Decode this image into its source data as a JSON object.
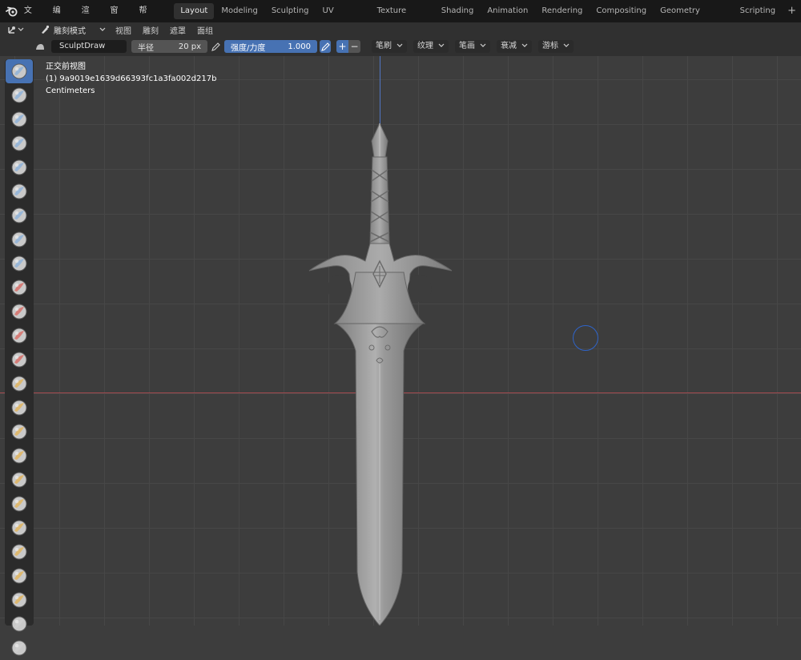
{
  "topbar": {
    "menus": [
      "文件",
      "编辑",
      "渲染",
      "窗口",
      "帮助"
    ],
    "workspace_tabs": [
      "Layout",
      "Modeling",
      "Sculpting",
      "UV Editing",
      "Texture Paint",
      "Shading",
      "Animation",
      "Rendering",
      "Compositing",
      "Geometry Nodes",
      "Scripting"
    ],
    "active_tab": "Layout",
    "add_tab_label": "+"
  },
  "header": {
    "mode": "雕刻模式",
    "menus": [
      "视图",
      "雕刻",
      "遮罩",
      "面组"
    ]
  },
  "tool_settings": {
    "brush_name": "SculptDraw",
    "radius_label": "半径",
    "radius_value": "20 px",
    "strength_label": "强度/力度",
    "strength_value": "1.000",
    "strength_fill": 1.0,
    "direction_add": "+",
    "direction_subtract": "−",
    "dropdowns": [
      "笔刷",
      "纹理",
      "笔画",
      "衰减",
      "游标"
    ]
  },
  "viewport": {
    "view_name": "正交前视图",
    "object_name": "(1) 9a9019e1639d66393fc1a3fa002d217b",
    "units": "Centimeters"
  },
  "toolbar": {
    "tools": [
      "draw",
      "draw-sharp",
      "clay",
      "clay-strips",
      "clay-thumb",
      "layer",
      "inflate",
      "blob",
      "crease",
      "smooth",
      "flatten",
      "fill",
      "scrape",
      "multiplane-scrape",
      "pinch",
      "grab",
      "elastic-deform",
      "snake-hook",
      "thumb",
      "pose",
      "nudge",
      "rotate",
      "slide-relax",
      "boundary",
      "cloth"
    ],
    "active_index": 0
  },
  "colors": {
    "accent": "#4772b3",
    "x_axis": "#a54a4f",
    "z_axis": "#5075c2",
    "viewport_bg": "#3d3d3d",
    "cursor_ring": "#2f64c9"
  }
}
